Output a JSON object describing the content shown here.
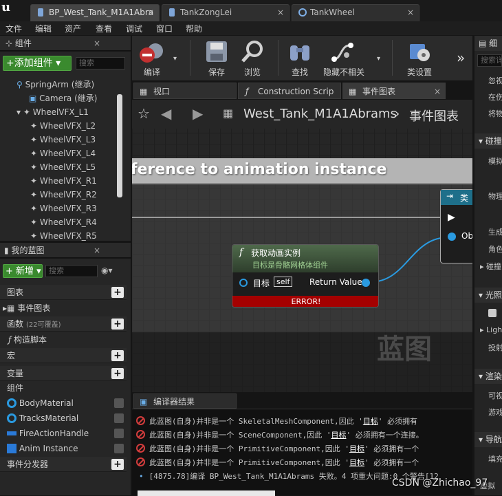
{
  "tabs": [
    {
      "label": "BP_West_Tank_M1A1Abra",
      "active": true
    },
    {
      "label": "TankZongLei",
      "active": false
    },
    {
      "label": "TankWheel",
      "active": false
    }
  ],
  "menu": [
    "文件",
    "编辑",
    "资产",
    "查看",
    "调试",
    "窗口",
    "帮助"
  ],
  "components": {
    "title": "组件",
    "add_label": "+添加组件 ▾",
    "search_placeholder": "搜索",
    "items": [
      "SpringArm (继承)",
      "Camera (继承)",
      "WheelVFX_L1",
      "WheelVFX_L2",
      "WheelVFX_L3",
      "WheelVFX_L4",
      "WheelVFX_L5",
      "WheelVFX_R1",
      "WheelVFX_R2",
      "WheelVFX_R3",
      "WheelVFX_R4",
      "WheelVFX_R5"
    ]
  },
  "my_blueprint": {
    "title": "我的蓝图",
    "new_label": "+ 新增 ▾",
    "search_placeholder": "搜索",
    "graphs_label": "图表",
    "event_graph_label": "事件图表",
    "functions_label": "函数",
    "functions_override": "(22可覆盖)",
    "construction_label": "构造脚本",
    "macros_label": "宏",
    "variables_label": "变量",
    "components_label": "组件",
    "variables": [
      "BodyMaterial",
      "TracksMaterial",
      "FireActionHandle",
      "Anim Instance"
    ],
    "dispatchers_label": "事件分发器"
  },
  "toolbar": {
    "compile": "编译",
    "save": "保存",
    "browse": "浏览",
    "find": "查找",
    "hide_unrelated": "隐藏不相关",
    "class_settings": "类设置"
  },
  "graph_tabs": [
    "视口",
    "Construction Scrip",
    "事件图表"
  ],
  "breadcrumb": {
    "path": "West_Tank_M1A1Abrams",
    "current": "事件图表"
  },
  "comment_title": "ference to animation instance",
  "node": {
    "title": "获取动画实例",
    "subtitle": "目标是骨骼网格体组件",
    "target_label": "目标",
    "self_label": "self",
    "return_label": "Return Value",
    "error_label": "ERROR!"
  },
  "cast_node": {
    "title": "类",
    "pin": "Ob"
  },
  "watermark": "蓝图",
  "compiler": {
    "title": "编译器结果",
    "rows": [
      {
        "pre": "此蓝图(自身)并非是一个 SkeletalMeshComponent,因此 '",
        "target": "目标",
        "post": "' 必须拥有"
      },
      {
        "pre": "此蓝图(自身)并非是一个 SceneComponent,因此 '",
        "target": "目标",
        "post": "' 必须拥有一个连接。"
      },
      {
        "pre": "此蓝图(自身)并非是一个 PrimitiveComponent,因此 '",
        "target": "目标",
        "post": "' 必须拥有一个"
      },
      {
        "pre": "此蓝图(自身)并非是一个 PrimitiveComponent,因此 '",
        "target": "目标",
        "post": "' 必须拥有一个"
      }
    ],
    "summary": "[4875.78]编译 BP_West_Tank_M1A1Abrams 失败。4 项重大问题:0 个警告[12"
  },
  "details": {
    "search_placeholder": "搜索详",
    "items": [
      "忽视",
      "在伤",
      "将物",
      "碰撞",
      "模拟",
      "物理",
      "生成",
      "角色",
      "碰撞",
      "光照",
      "Ligh",
      "投射",
      "渲染",
      "可视",
      "游戏",
      "导航",
      "填充",
      "虚拟"
    ]
  },
  "watermark_csdn": "CSDN @Zhichao_97",
  "colors": {
    "accent_green": "#3a8a2e",
    "error_red": "#a40000",
    "pin_blue": "#2a9ae0",
    "node_header": "#3c5a3a"
  }
}
